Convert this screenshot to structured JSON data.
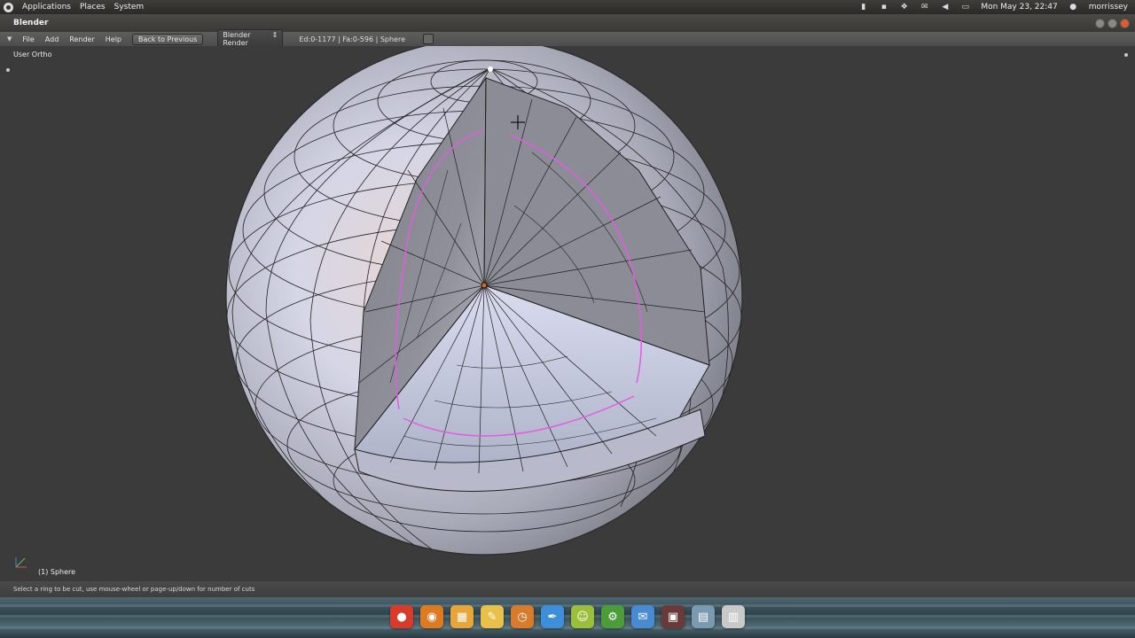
{
  "gnome_panel": {
    "menus": [
      "Applications",
      "Places",
      "System"
    ],
    "clock": "Mon May 23, 22:47",
    "user": "morrissey",
    "tray_icons": [
      "clipboard-icon",
      "network-icon",
      "dropbox-icon",
      "mail-icon",
      "volume-icon",
      "chat-icon",
      "user-icon"
    ]
  },
  "window": {
    "title": "Blender"
  },
  "header": {
    "menu": [
      "File",
      "Add",
      "Render",
      "Help"
    ],
    "back_button": "Back to Previous",
    "render_engine": "Blender Render",
    "stats": "Ed:0-1177 | Fa:0-596 | Sphere"
  },
  "viewport": {
    "view_label": "User Ortho",
    "object_label": "(1) Sphere"
  },
  "status_bar": {
    "text": "Select a ring to be cut, use mouse-wheel or page-up/down for number of cuts"
  },
  "dock": {
    "icons": [
      {
        "name": "chrome-icon",
        "color": "#d93b2b"
      },
      {
        "name": "blender-icon",
        "color": "#e07a22"
      },
      {
        "name": "photos-icon",
        "color": "#e8a53a"
      },
      {
        "name": "notes-icon",
        "color": "#e9c04a"
      },
      {
        "name": "clock-icon",
        "color": "#d97b2c"
      },
      {
        "name": "inkscape-icon",
        "color": "#3c8fd8"
      },
      {
        "name": "pidgin-icon",
        "color": "#9bbf3a"
      },
      {
        "name": "utility-icon",
        "color": "#4b9d3a"
      },
      {
        "name": "chat-icon",
        "color": "#4a8ad0"
      },
      {
        "name": "terminal-icon",
        "color": "#6a3a3a"
      },
      {
        "name": "top-icon",
        "color": "#7b9ab0"
      },
      {
        "name": "trash-icon",
        "color": "#c9c9c9"
      }
    ]
  },
  "colors": {
    "viewport_bg": "#3b3b3b",
    "loop_cut_preview": "#e05ce0",
    "sphere_light": "#dcdff0",
    "sphere_shadow": "#7a7c85"
  }
}
